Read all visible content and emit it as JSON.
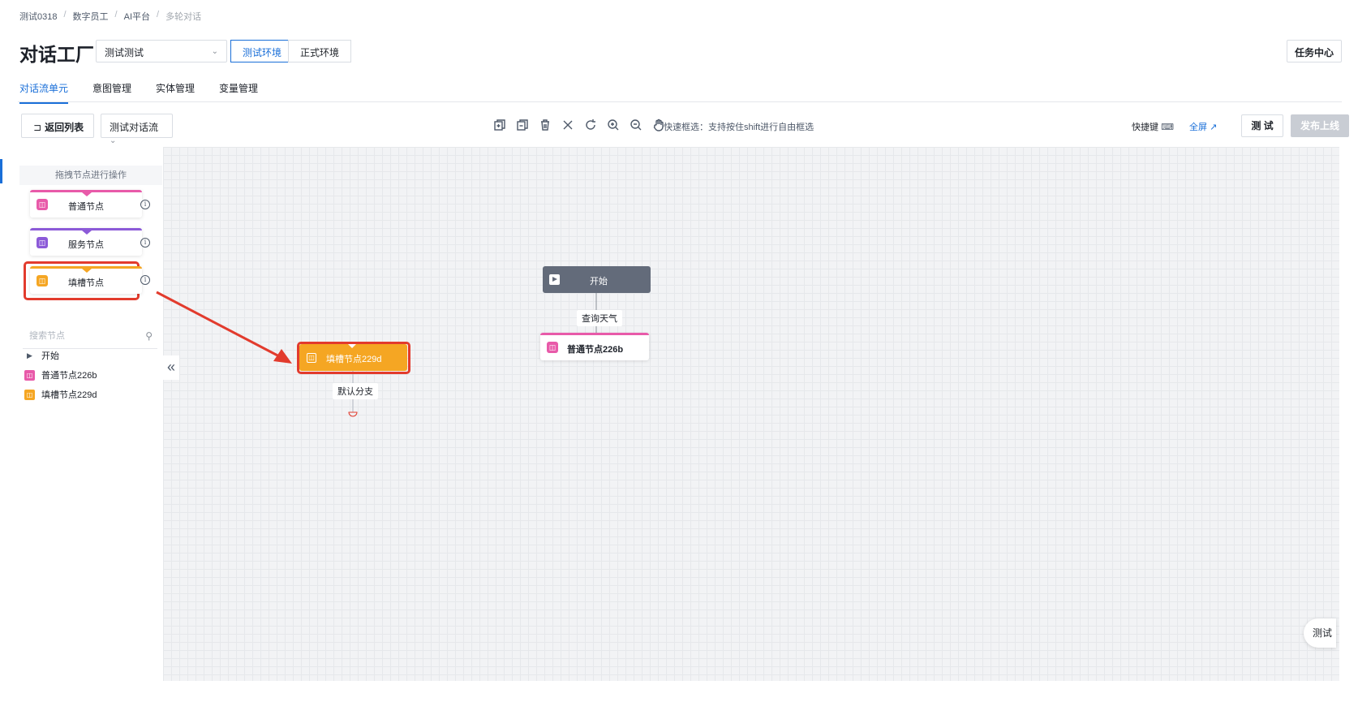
{
  "breadcrumb": [
    "测试0318",
    "数字员工",
    "AI平台",
    "多轮对话"
  ],
  "page_title": "对话工厂",
  "bot_select": {
    "value": "测试测试"
  },
  "env": {
    "test_label": "测试环境",
    "prod_label": "正式环境",
    "active": "test"
  },
  "task_center_label": "任务中心",
  "tabs": [
    {
      "label": "对话流单元",
      "active": true
    },
    {
      "label": "意图管理",
      "active": false
    },
    {
      "label": "实体管理",
      "active": false
    },
    {
      "label": "变量管理",
      "active": false
    }
  ],
  "toolbar": {
    "back_label": "返回列表",
    "flow_select": "测试对话流",
    "icons": [
      "copy-node-icon",
      "paste-node-icon",
      "delete-icon",
      "close-icon",
      "refresh-icon",
      "zoom-in-icon",
      "zoom-out-icon",
      "hand-pan-icon"
    ],
    "hint": "快速框选：支持按住shift进行自由框选",
    "shortcut_label": "快捷键",
    "fullscreen_label": "全屏",
    "test_label": "测 试",
    "publish_label": "发布上线"
  },
  "palette": {
    "title": "拖拽节点进行操作",
    "nodes": [
      {
        "label": "普通节点",
        "color": "#e85aa9",
        "icon": "robot-icon"
      },
      {
        "label": "服务节点",
        "color": "#8c5ad8",
        "icon": "service-icon"
      },
      {
        "label": "填槽节点",
        "color": "#f5a623",
        "icon": "slot-icon"
      }
    ],
    "search_placeholder": "搜索节点",
    "tree": [
      {
        "label": "开始",
        "icon": "play-triangle-icon"
      },
      {
        "label": "普通节点226b",
        "icon": "robot-icon",
        "color": "#e85aa9"
      },
      {
        "label": "填槽节点229d",
        "icon": "slot-icon",
        "color": "#f5a623"
      }
    ]
  },
  "canvas": {
    "start_node": "开始",
    "edge_start_to_normal": "查询天气",
    "normal_node": "普通节点226b",
    "slot_node": "填槽节点229d",
    "edge_slot_default": "默认分支"
  },
  "floating_test_label": "测试",
  "colors": {
    "accent": "#1a6fd8",
    "annotation": "#e23b2d",
    "normal": "#e85aa9",
    "service": "#8c5ad8",
    "slot": "#f5a623"
  }
}
